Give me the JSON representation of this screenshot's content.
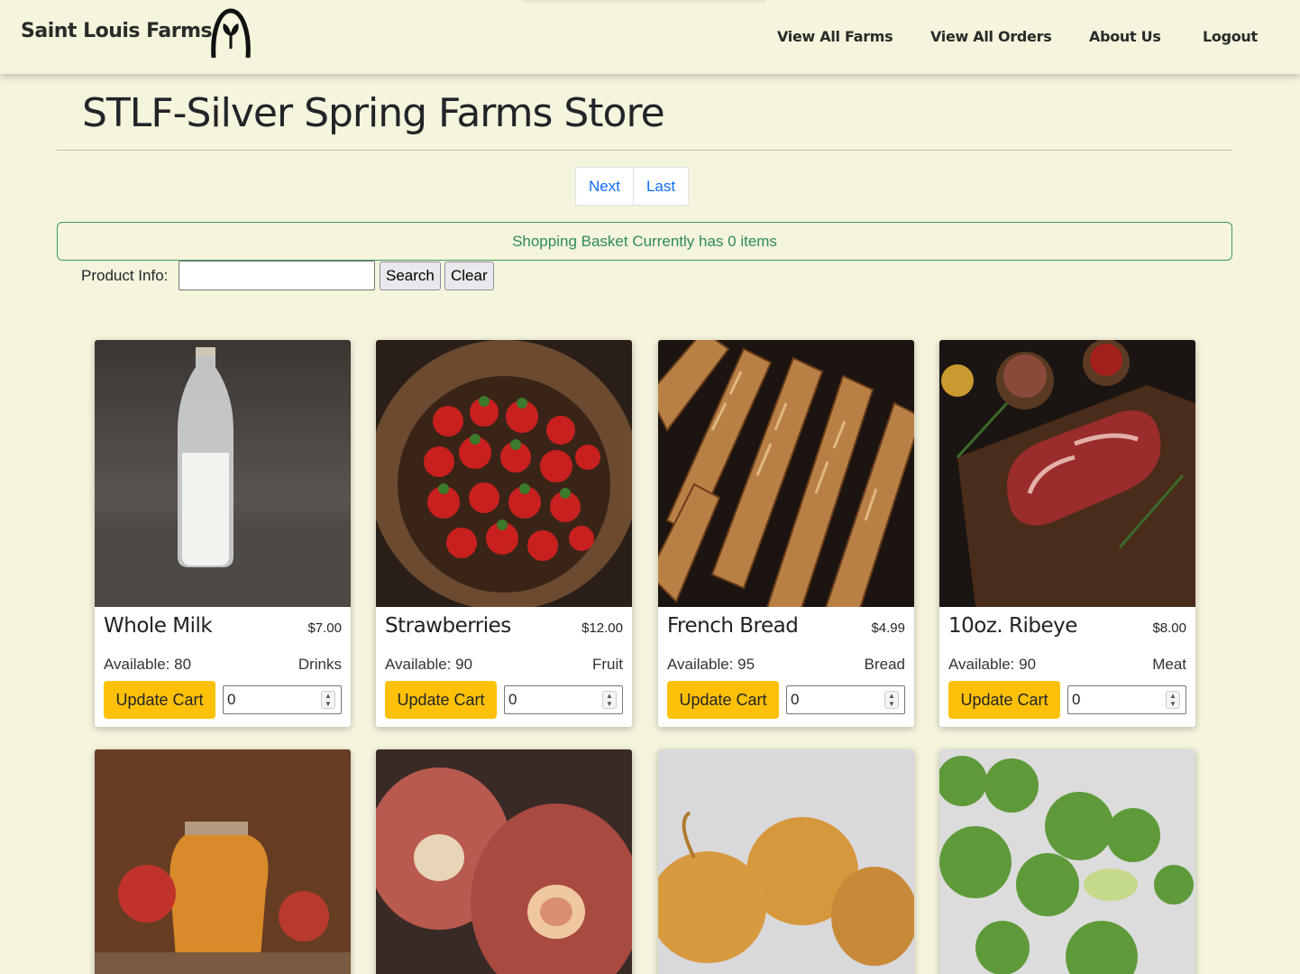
{
  "header": {
    "brand": "Saint Louis Farms",
    "nav": [
      "View All Farms",
      "View All Orders",
      "About Us",
      "Logout"
    ]
  },
  "page": {
    "title": "STLF-Silver Spring Farms Store",
    "pagination": [
      "Next",
      "Last"
    ],
    "basket_message": "Shopping Basket Currently has 0 items"
  },
  "search": {
    "label": "Product Info:",
    "value": "",
    "search_button": "Search",
    "clear_button": "Clear"
  },
  "products": [
    {
      "name": "Whole Milk",
      "price": "$7.00",
      "available": "Available: 80",
      "category": "Drinks",
      "button": "Update Cart",
      "qty": "0",
      "image": "milk"
    },
    {
      "name": "Strawberries",
      "price": "$12.00",
      "available": "Available: 90",
      "category": "Fruit",
      "button": "Update Cart",
      "qty": "0",
      "image": "strawberries"
    },
    {
      "name": "French Bread",
      "price": "$4.99",
      "available": "Available: 95",
      "category": "Bread",
      "button": "Update Cart",
      "qty": "0",
      "image": "bread"
    },
    {
      "name": "10oz. Ribeye",
      "price": "$8.00",
      "available": "Available: 90",
      "category": "Meat",
      "button": "Update Cart",
      "qty": "0",
      "image": "ribeye"
    },
    {
      "image": "apple-juice"
    },
    {
      "image": "soup-bones"
    },
    {
      "image": "onions"
    },
    {
      "image": "brussels-sprouts"
    }
  ]
}
